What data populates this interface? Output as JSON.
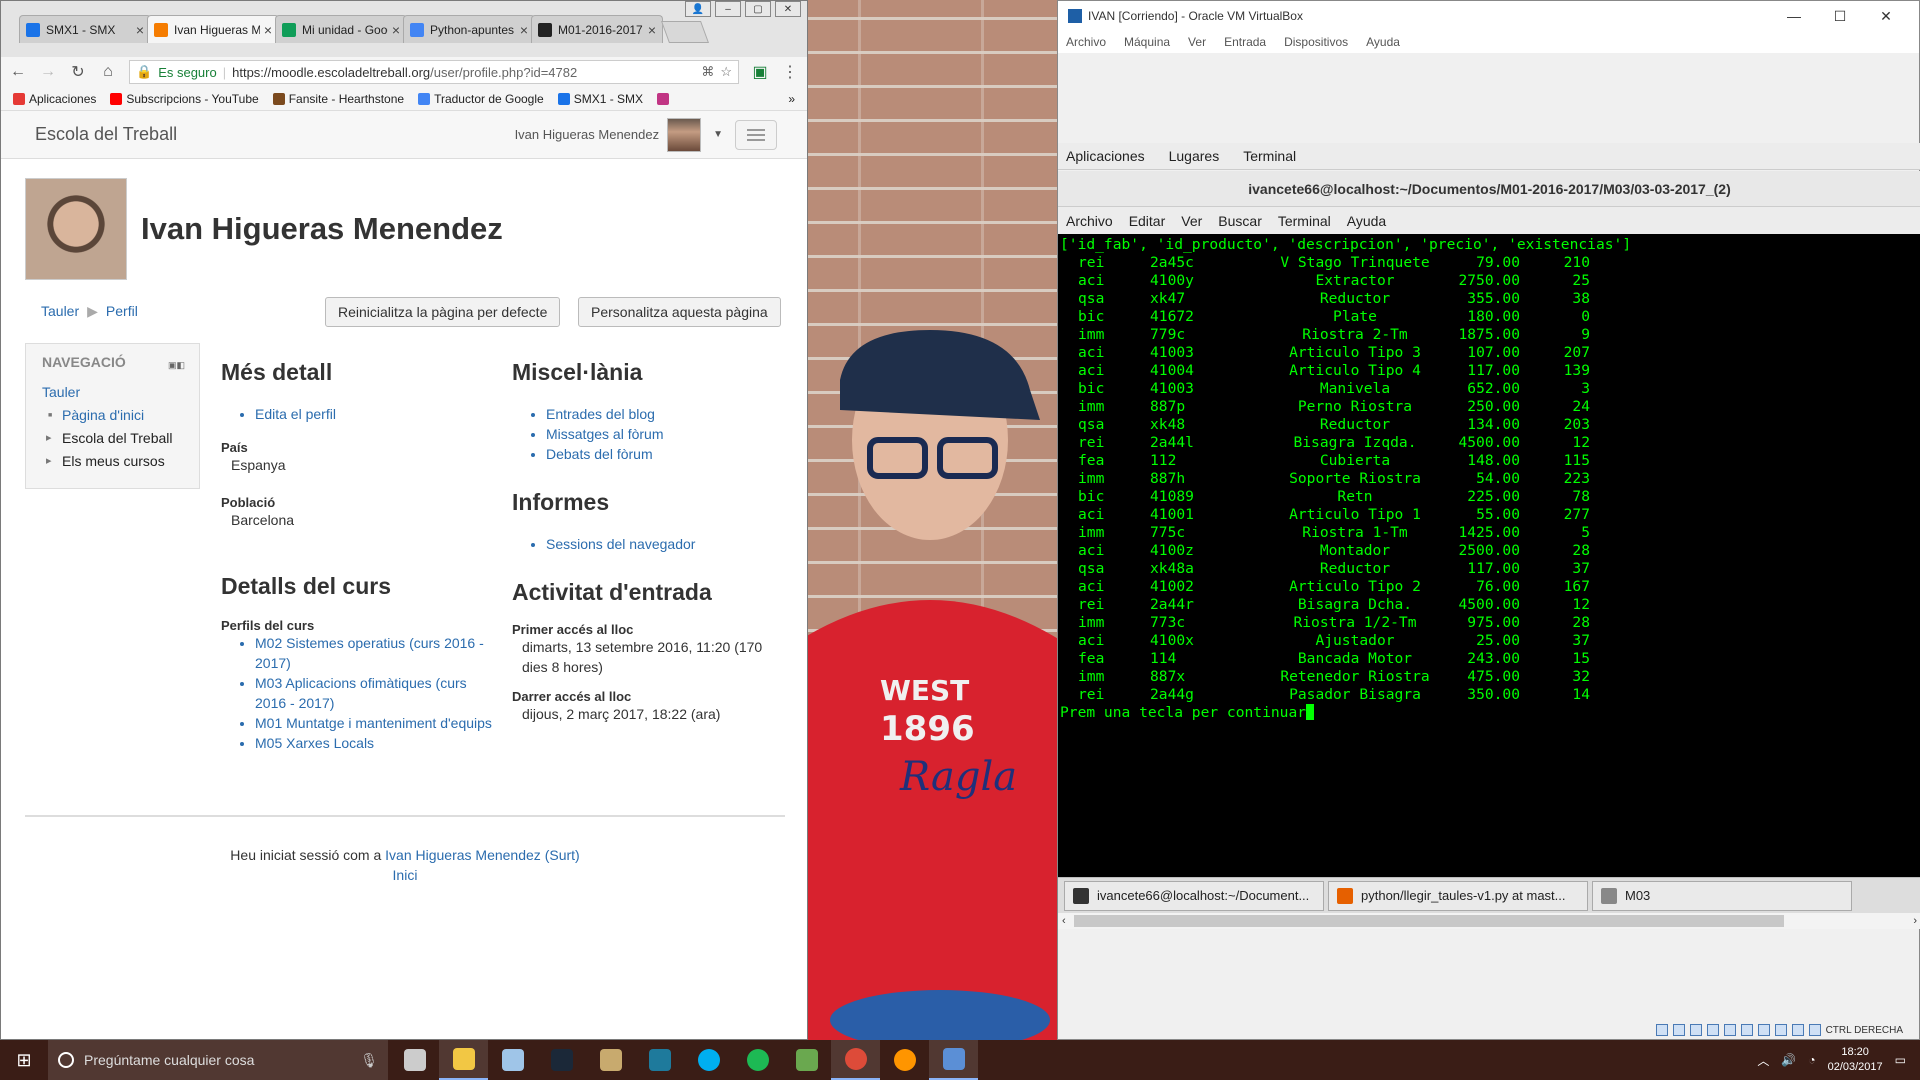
{
  "browser": {
    "tabs": [
      {
        "label": "SMX1 - SMX",
        "color": "#1a73e8"
      },
      {
        "label": "Ivan Higueras Menendez",
        "color": "#f57c00"
      },
      {
        "label": "Mi unidad - Google Drive",
        "color": "#0f9d58"
      },
      {
        "label": "Python-apuntes",
        "color": "#4285f4"
      },
      {
        "label": "M01-2016-2017",
        "color": "#222222"
      }
    ],
    "active_tab": 1,
    "secure_label": "Es seguro",
    "url_host": "https://moodle.escoladeltreball.org",
    "url_path": "/user/profile.php?id=4782",
    "bookmarks": [
      {
        "label": "Aplicaciones",
        "color": "#e53935"
      },
      {
        "label": "Subscripcions - YouTube",
        "color": "#ff0000"
      },
      {
        "label": "Fansite - Hearthstone",
        "color": "#7b4a1e"
      },
      {
        "label": "Traductor de Google",
        "color": "#4285f4"
      },
      {
        "label": "SMX1 - SMX",
        "color": "#1a73e8"
      },
      {
        "label": "",
        "color": "#c13584"
      }
    ],
    "more": "»"
  },
  "moodle": {
    "brand": "Escola del Treball",
    "user": "Ivan Higueras Menendez",
    "name": "Ivan Higueras Menendez",
    "crumb": [
      "Tauler",
      "Perfil"
    ],
    "reset_button": "Reinicialitza la pàgina per defecte",
    "customize_button": "Personalitza aquesta pàgina",
    "nav": {
      "title": "NAVEGACIÓ",
      "top": "Tauler",
      "items": [
        "Pàgina d'inici",
        "Escola del Treball",
        "Els meus cursos"
      ]
    },
    "details": {
      "title": "Més detall",
      "edit": "Edita el perfil",
      "country_label": "País",
      "country": "Espanya",
      "city_label": "Població",
      "city": "Barcelona"
    },
    "course": {
      "title": "Detalls del curs",
      "profiles_label": "Perfils del curs",
      "courses": [
        "M02 Sistemes operatius (curs 2016 - 2017)",
        "M03 Aplicacions ofimàtiques (curs 2016 - 2017)",
        "M01 Muntatge i manteniment d'equips",
        "M05 Xarxes Locals"
      ]
    },
    "misc": {
      "title": "Miscel·lània",
      "links": [
        "Entrades del blog",
        "Missatges al fòrum",
        "Debats del fòrum"
      ]
    },
    "reports": {
      "title": "Informes",
      "links": [
        "Sessions del navegador"
      ]
    },
    "access": {
      "title": "Activitat d'entrada",
      "first_label": "Primer accés al lloc",
      "first": "dimarts, 13 setembre 2016, 11:20  (170 dies 8 hores)",
      "last_label": "Darrer accés al lloc",
      "last": "dijous, 2 març 2017, 18:22  (ara)"
    },
    "footer": {
      "prefix": "Heu iniciat sessió com a",
      "user": "Ivan Higueras Menendez",
      "logout": "(Surt)",
      "home": "Inici"
    }
  },
  "vbox": {
    "title": "IVAN [Corriendo] - Oracle VM VirtualBox",
    "menu": [
      "Archivo",
      "Máquina",
      "Ver",
      "Entrada",
      "Dispositivos",
      "Ayuda"
    ],
    "guest_panel": [
      "Aplicaciones",
      "Lugares",
      "Terminal"
    ],
    "term_title": "ivancete66@localhost:~/Documentos/M01-2016-2017/M03/03-03-2017_(2)",
    "term_menu": [
      "Archivo",
      "Editar",
      "Ver",
      "Buscar",
      "Terminal",
      "Ayuda"
    ],
    "header_line": "['id_fab', 'id_producto', 'descripcion', 'precio', 'existencias']",
    "rows": [
      [
        "rei",
        "2a45c",
        "V Stago Trinquete",
        "79.00",
        "210"
      ],
      [
        "aci",
        "4100y",
        "Extractor",
        "2750.00",
        "25"
      ],
      [
        "qsa",
        "xk47",
        "Reductor",
        "355.00",
        "38"
      ],
      [
        "bic",
        "41672",
        "Plate",
        "180.00",
        "0"
      ],
      [
        "imm",
        "779c",
        "Riostra 2-Tm",
        "1875.00",
        "9"
      ],
      [
        "aci",
        "41003",
        "Articulo Tipo 3",
        "107.00",
        "207"
      ],
      [
        "aci",
        "41004",
        "Articulo Tipo 4",
        "117.00",
        "139"
      ],
      [
        "bic",
        "41003",
        "Manivela",
        "652.00",
        "3"
      ],
      [
        "imm",
        "887p",
        "Perno Riostra",
        "250.00",
        "24"
      ],
      [
        "qsa",
        "xk48",
        "Reductor",
        "134.00",
        "203"
      ],
      [
        "rei",
        "2a44l",
        "Bisagra Izqda.",
        "4500.00",
        "12"
      ],
      [
        "fea",
        "112",
        "Cubierta",
        "148.00",
        "115"
      ],
      [
        "imm",
        "887h",
        "Soporte Riostra",
        "54.00",
        "223"
      ],
      [
        "bic",
        "41089",
        "Retn",
        "225.00",
        "78"
      ],
      [
        "aci",
        "41001",
        "Articulo Tipo 1",
        "55.00",
        "277"
      ],
      [
        "imm",
        "775c",
        "Riostra 1-Tm",
        "1425.00",
        "5"
      ],
      [
        "aci",
        "4100z",
        "Montador",
        "2500.00",
        "28"
      ],
      [
        "qsa",
        "xk48a",
        "Reductor",
        "117.00",
        "37"
      ],
      [
        "aci",
        "41002",
        "Articulo Tipo 2",
        "76.00",
        "167"
      ],
      [
        "rei",
        "2a44r",
        "Bisagra Dcha.",
        "4500.00",
        "12"
      ],
      [
        "imm",
        "773c",
        "Riostra 1/2-Tm",
        "975.00",
        "28"
      ],
      [
        "aci",
        "4100x",
        "Ajustador",
        "25.00",
        "37"
      ],
      [
        "fea",
        "114",
        "Bancada Motor",
        "243.00",
        "15"
      ],
      [
        "imm",
        "887x",
        "Retenedor Riostra",
        "475.00",
        "32"
      ],
      [
        "rei",
        "2a44g",
        "Pasador Bisagra",
        "350.00",
        "14"
      ]
    ],
    "prompt": "Prem una tecla per continuar",
    "guest_tasks": [
      {
        "label": "ivancete66@localhost:~/Document...",
        "color": "#333333"
      },
      {
        "label": "python/llegir_taules-v1.py at mast...",
        "color": "#e66000"
      },
      {
        "label": "M03",
        "color": "#888888"
      }
    ],
    "host_key": "CTRL DERECHA"
  },
  "taskbar": {
    "search_placeholder": "Pregúntame cualquier cosa",
    "apps": [
      {
        "name": "task-view",
        "color": "#cccccc"
      },
      {
        "name": "file-explorer",
        "color": "#f2c744"
      },
      {
        "name": "paint",
        "color": "#9fc5e8"
      },
      {
        "name": "steam",
        "color": "#1b2838"
      },
      {
        "name": "league",
        "color": "#c8aa6e"
      },
      {
        "name": "terminal",
        "color": "#1e7a9c"
      },
      {
        "name": "skype",
        "color": "#00aff0"
      },
      {
        "name": "spotify",
        "color": "#1db954"
      },
      {
        "name": "minecraft",
        "color": "#6aa84f"
      },
      {
        "name": "chrome",
        "color": "#dd4b39"
      },
      {
        "name": "firefox",
        "color": "#ff9500"
      },
      {
        "name": "virtualbox",
        "color": "#5b8fd6"
      }
    ],
    "time": "18:20",
    "date": "02/03/2017"
  }
}
